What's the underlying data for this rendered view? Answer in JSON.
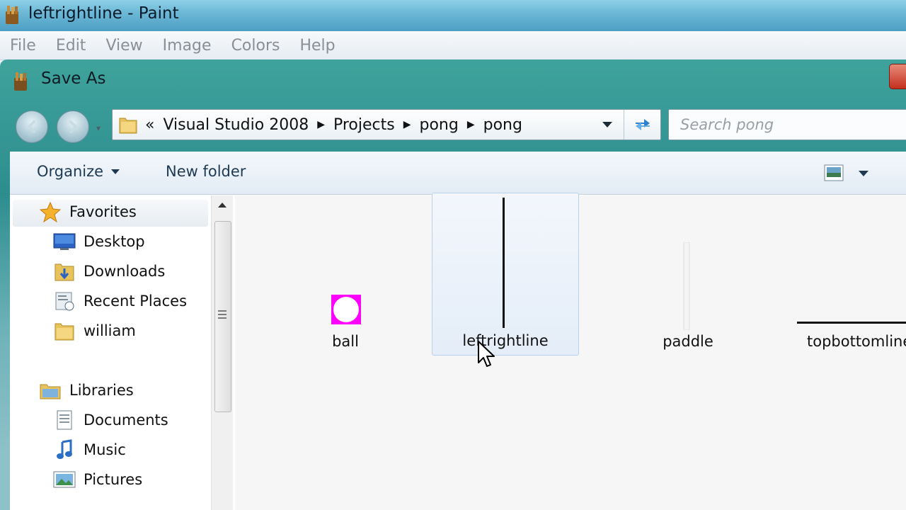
{
  "app": {
    "window_title": "leftrightline - Paint",
    "menu": [
      "File",
      "Edit",
      "View",
      "Image",
      "Colors",
      "Help"
    ]
  },
  "dialog": {
    "title": "Save As",
    "breadcrumb": {
      "overflow": "«",
      "parts": [
        "Visual Studio 2008",
        "Projects",
        "pong",
        "pong"
      ]
    },
    "search": {
      "placeholder": "Search pong",
      "value": ""
    },
    "toolbar": {
      "organize": "Organize",
      "new_folder": "New folder"
    },
    "nav": {
      "favorites_header": "Favorites",
      "favorites": [
        "Desktop",
        "Downloads",
        "Recent Places",
        "william"
      ],
      "libraries_header": "Libraries",
      "libraries": [
        "Documents",
        "Music",
        "Pictures"
      ]
    },
    "files": [
      {
        "name": "ball",
        "selected": false
      },
      {
        "name": "leftrightline",
        "selected": true
      },
      {
        "name": "paddle",
        "selected": false
      },
      {
        "name": "topbottomline",
        "selected": false
      }
    ]
  },
  "colors": {
    "ball_magenta": "#ff00ff",
    "selection_border": "#b7d1ef",
    "title_teal": "#2d8d8e"
  }
}
